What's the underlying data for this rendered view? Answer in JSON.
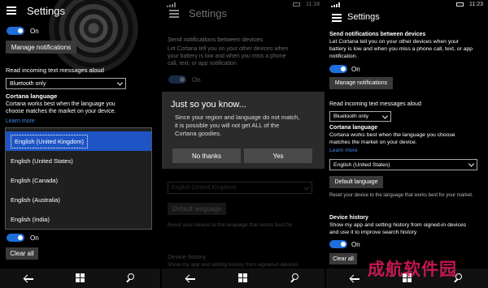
{
  "p1": {
    "title": "Settings",
    "toggle_top_label": "On",
    "manage_btn": "Manage notifications",
    "read_label": "Read incoming text messages aloud",
    "read_select": "Bluetooth only",
    "cortana_heading": "Cortana language",
    "cortana_desc_1": "Cortana works best when the language you",
    "cortana_desc_2": "choose matches the market on your device.",
    "learn_more": "Learn more",
    "languages": [
      "English (United Kingdom)",
      "English (United States)",
      "English (Canada)",
      "English (Australia)",
      "English (India)"
    ],
    "toggle_bottom_label": "On",
    "clear_all": "Clear all"
  },
  "p2": {
    "time": "11:18",
    "title": "Settings",
    "send_heading": "Send notifications between devices",
    "send_desc_1": "Let Cortana tell you on your other devices when",
    "send_desc_2": "your battery is low and when you miss a phone",
    "send_desc_3": "call, text, or app notification.",
    "toggle_label": "On",
    "dialog": {
      "title": "Just so you know...",
      "body_1": "Since your region and language do not match,",
      "body_2": "it is possible you will not get ALL of the",
      "body_3": "Cortana goodies.",
      "no_btn": "No thanks",
      "yes_btn": "Yes"
    },
    "lang_select": "English (United Kingdom)",
    "default_btn": "Default language",
    "reset_text": "Reset your device to the language that works best for",
    "history_heading": "Device history",
    "history_desc": "Show my app and setting history from signed-in devices"
  },
  "p3": {
    "time": "11:23",
    "title": "Settings",
    "send_heading": "Send notifications between devices",
    "send_desc_1": "Let Cortana tell you on your other devices when your",
    "send_desc_2": "battery is low and when you miss a phone call, text, or app",
    "send_desc_3": "notification.",
    "toggle1_label": "On",
    "manage_btn": "Manage notifications",
    "read_label": "Read incoming text messages aloud",
    "read_select": "Bluetooth only",
    "cortana_heading": "Cortana language",
    "cortana_desc_1": "Cortana works best when the language you choose",
    "cortana_desc_2": "matches the market on your device.",
    "learn_more": "Learn more",
    "lang_select": "English (United States)",
    "default_btn": "Default language",
    "reset_text": "Reset your device to the language that works best for your market.",
    "history_heading": "Device history",
    "history_desc_1": "Show my app and setting history from signed-in devices",
    "history_desc_2": "and use it to improve search history",
    "toggle2_label": "On",
    "clear_all": "Clear all"
  },
  "watermark": "成航软件园",
  "colors": {
    "accent": "#1e6fd9",
    "selection": "#1e54c4",
    "link": "#3b8ee8",
    "watermark": "#d91a5a"
  },
  "icons": [
    "hamburger-icon",
    "back-icon",
    "windows-icon",
    "search-icon",
    "chevron-down-icon",
    "signal-icon",
    "battery-icon"
  ]
}
